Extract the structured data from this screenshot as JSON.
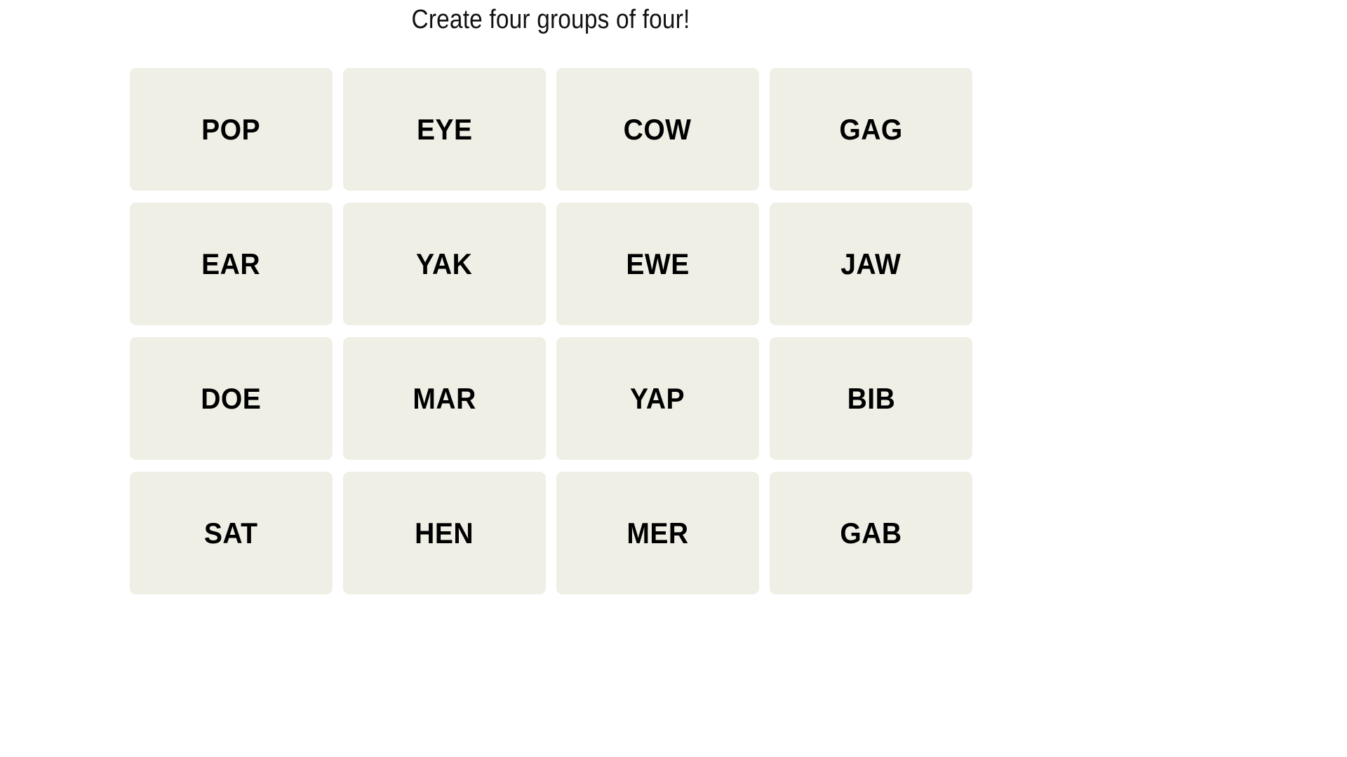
{
  "page": {
    "background_color": "#ffffff"
  },
  "header": {
    "title": "Create four groups of four!"
  },
  "board": {
    "rows": 4,
    "columns": 4,
    "tile_color": "#efefe6",
    "tile_text_color": "#000000",
    "tiles": [
      {
        "label": "POP"
      },
      {
        "label": "EYE"
      },
      {
        "label": "COW"
      },
      {
        "label": "GAG"
      },
      {
        "label": "EAR"
      },
      {
        "label": "YAK"
      },
      {
        "label": "EWE"
      },
      {
        "label": "JAW"
      },
      {
        "label": "DOE"
      },
      {
        "label": "MAR"
      },
      {
        "label": "YAP"
      },
      {
        "label": "BIB"
      },
      {
        "label": "SAT"
      },
      {
        "label": "HEN"
      },
      {
        "label": "MER"
      },
      {
        "label": "GAB"
      }
    ]
  }
}
